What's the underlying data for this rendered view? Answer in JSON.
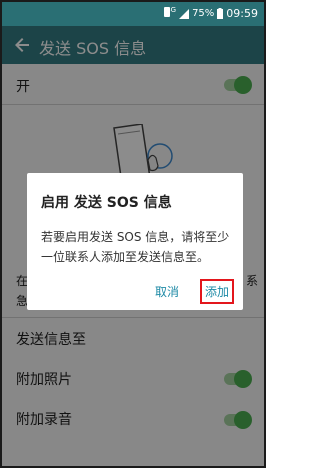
{
  "status_bar": {
    "network": "4G",
    "battery": "75%",
    "time": "09:59"
  },
  "app_bar": {
    "title": "发送 SOS 信息"
  },
  "settings": {
    "master": {
      "label": "开",
      "on": true
    },
    "hidden_partial_left": [
      "在",
      "急"
    ],
    "hidden_partial_right": [
      "系",
      ""
    ],
    "send_to_label": "发送信息至",
    "attach_photo": {
      "label": "附加照片",
      "on": true
    },
    "attach_audio": {
      "label": "附加录音",
      "on": true
    }
  },
  "dialog": {
    "title": "启用 发送 SOS 信息",
    "message": "若要启用发送 SOS 信息，请将至少一位联系人添加至发送信息至。",
    "cancel_label": "取消",
    "add_label": "添加"
  },
  "colors": {
    "app_bar": "#337d84",
    "status_bar": "#2a6f74",
    "accent": "#1e8aa6",
    "toggle_on": "#4caf50",
    "highlight_border": "#e3161c"
  }
}
